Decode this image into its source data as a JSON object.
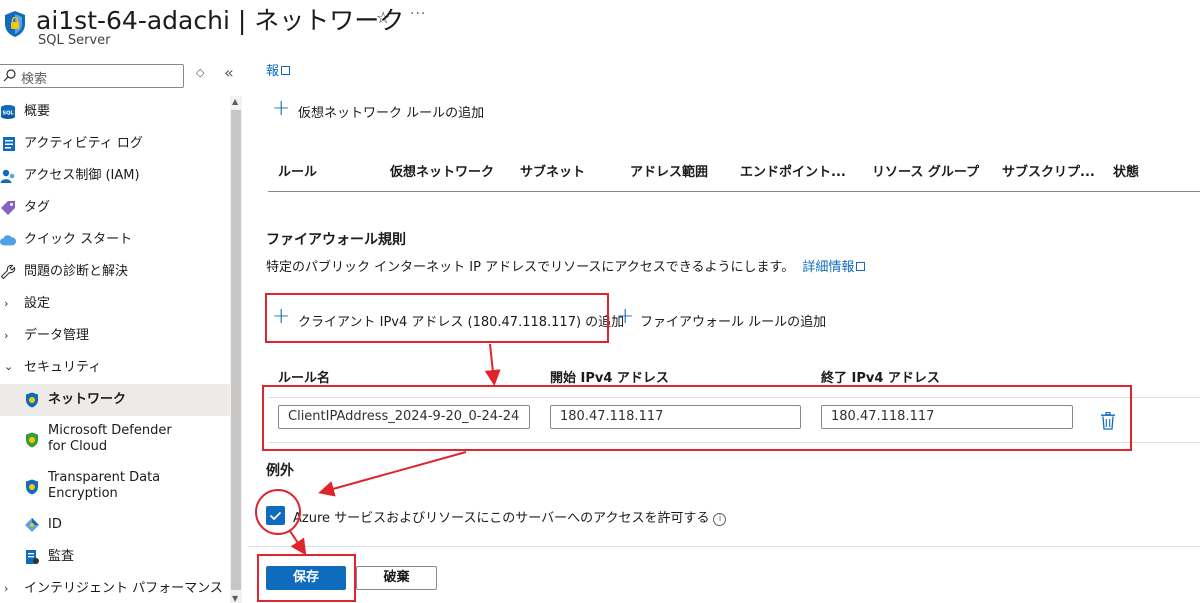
{
  "header": {
    "title": "ai1st-64-adachi | ネットワーク",
    "subtitle": "SQL Server",
    "star_icon": "star-icon",
    "more": "···"
  },
  "sidebar": {
    "search_placeholder": "検索",
    "sort_glyph": "◇",
    "collapse_glyph": "«",
    "items": [
      {
        "label": "概要",
        "icon": "sql-icon"
      },
      {
        "label": "アクティビティ ログ",
        "icon": "activity-log-icon"
      },
      {
        "label": "アクセス制御 (IAM)",
        "icon": "iam-icon"
      },
      {
        "label": "タグ",
        "icon": "tag-icon"
      },
      {
        "label": "クイック スタート",
        "icon": "cloud-icon"
      },
      {
        "label": "問題の診断と解決",
        "icon": "wrench-icon"
      },
      {
        "label": "設定",
        "icon": "chevron-right-icon"
      },
      {
        "label": "データ管理",
        "icon": "chevron-right-icon"
      },
      {
        "label": "セキュリティ",
        "icon": "chevron-down-icon"
      },
      {
        "label": "ネットワーク",
        "icon": "shield-icon"
      },
      {
        "label": "Microsoft Defender\nfor Cloud",
        "line1": "Microsoft Defender",
        "line2": "for Cloud",
        "icon": "defender-icon"
      },
      {
        "label": "Transparent Data\nEncryption",
        "line1": "Transparent Data",
        "line2": "Encryption",
        "icon": "shield-icon"
      },
      {
        "label": "ID",
        "icon": "id-icon"
      },
      {
        "label": "監査",
        "icon": "audit-icon"
      },
      {
        "label": "インテリジェント パフォーマンス",
        "icon": "chevron-right-icon"
      }
    ]
  },
  "main": {
    "top_link": "報",
    "add_vnet_rule": "仮想ネットワーク ルールの追加",
    "vnet_table_headers": [
      "ルール",
      "仮想ネットワーク",
      "サブネット",
      "アドレス範囲",
      "エンドポイント...",
      "リソース グループ",
      "サブスクリプ...",
      "状態"
    ],
    "firewall_title": "ファイアウォール規則",
    "firewall_desc": "特定のパブリック インターネット IP アドレスでリソースにアクセスできるようにします。",
    "learn_more": "詳細情報",
    "add_client_ip": "クライアント IPv4 アドレス (180.47.118.117) の追加",
    "add_firewall_rule": "ファイアウォール ルールの追加",
    "rule_headers": [
      "ルール名",
      "開始 IPv4 アドレス",
      "終了 IPv4 アドレス"
    ],
    "rule_row": {
      "name": "ClientIPAddress_2024-9-20_0-24-24",
      "start_ip": "180.47.118.117",
      "end_ip": "180.47.118.117"
    },
    "exceptions_title": "例外",
    "allow_azure_label": "Azure サービスおよびリソースにこのサーバーへのアクセスを許可する",
    "allow_azure_checked": true,
    "save_label": "保存",
    "discard_label": "破棄"
  },
  "colors": {
    "accent": "#0f6cbd",
    "annotation": "#e0242b"
  }
}
